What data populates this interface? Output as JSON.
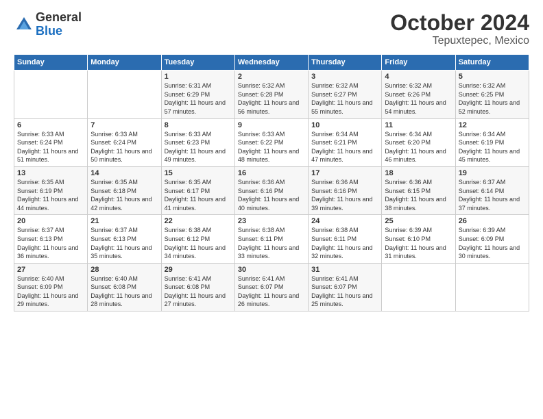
{
  "header": {
    "logo_general": "General",
    "logo_blue": "Blue",
    "title": "October 2024",
    "subtitle": "Tepuxtepec, Mexico"
  },
  "days_of_week": [
    "Sunday",
    "Monday",
    "Tuesday",
    "Wednesday",
    "Thursday",
    "Friday",
    "Saturday"
  ],
  "weeks": [
    [
      {
        "day": "",
        "data": ""
      },
      {
        "day": "",
        "data": ""
      },
      {
        "day": "1",
        "data": "Sunrise: 6:31 AM\nSunset: 6:29 PM\nDaylight: 11 hours and 57 minutes."
      },
      {
        "day": "2",
        "data": "Sunrise: 6:32 AM\nSunset: 6:28 PM\nDaylight: 11 hours and 56 minutes."
      },
      {
        "day": "3",
        "data": "Sunrise: 6:32 AM\nSunset: 6:27 PM\nDaylight: 11 hours and 55 minutes."
      },
      {
        "day": "4",
        "data": "Sunrise: 6:32 AM\nSunset: 6:26 PM\nDaylight: 11 hours and 54 minutes."
      },
      {
        "day": "5",
        "data": "Sunrise: 6:32 AM\nSunset: 6:25 PM\nDaylight: 11 hours and 52 minutes."
      }
    ],
    [
      {
        "day": "6",
        "data": "Sunrise: 6:33 AM\nSunset: 6:24 PM\nDaylight: 11 hours and 51 minutes."
      },
      {
        "day": "7",
        "data": "Sunrise: 6:33 AM\nSunset: 6:24 PM\nDaylight: 11 hours and 50 minutes."
      },
      {
        "day": "8",
        "data": "Sunrise: 6:33 AM\nSunset: 6:23 PM\nDaylight: 11 hours and 49 minutes."
      },
      {
        "day": "9",
        "data": "Sunrise: 6:33 AM\nSunset: 6:22 PM\nDaylight: 11 hours and 48 minutes."
      },
      {
        "day": "10",
        "data": "Sunrise: 6:34 AM\nSunset: 6:21 PM\nDaylight: 11 hours and 47 minutes."
      },
      {
        "day": "11",
        "data": "Sunrise: 6:34 AM\nSunset: 6:20 PM\nDaylight: 11 hours and 46 minutes."
      },
      {
        "day": "12",
        "data": "Sunrise: 6:34 AM\nSunset: 6:19 PM\nDaylight: 11 hours and 45 minutes."
      }
    ],
    [
      {
        "day": "13",
        "data": "Sunrise: 6:35 AM\nSunset: 6:19 PM\nDaylight: 11 hours and 44 minutes."
      },
      {
        "day": "14",
        "data": "Sunrise: 6:35 AM\nSunset: 6:18 PM\nDaylight: 11 hours and 42 minutes."
      },
      {
        "day": "15",
        "data": "Sunrise: 6:35 AM\nSunset: 6:17 PM\nDaylight: 11 hours and 41 minutes."
      },
      {
        "day": "16",
        "data": "Sunrise: 6:36 AM\nSunset: 6:16 PM\nDaylight: 11 hours and 40 minutes."
      },
      {
        "day": "17",
        "data": "Sunrise: 6:36 AM\nSunset: 6:16 PM\nDaylight: 11 hours and 39 minutes."
      },
      {
        "day": "18",
        "data": "Sunrise: 6:36 AM\nSunset: 6:15 PM\nDaylight: 11 hours and 38 minutes."
      },
      {
        "day": "19",
        "data": "Sunrise: 6:37 AM\nSunset: 6:14 PM\nDaylight: 11 hours and 37 minutes."
      }
    ],
    [
      {
        "day": "20",
        "data": "Sunrise: 6:37 AM\nSunset: 6:13 PM\nDaylight: 11 hours and 36 minutes."
      },
      {
        "day": "21",
        "data": "Sunrise: 6:37 AM\nSunset: 6:13 PM\nDaylight: 11 hours and 35 minutes."
      },
      {
        "day": "22",
        "data": "Sunrise: 6:38 AM\nSunset: 6:12 PM\nDaylight: 11 hours and 34 minutes."
      },
      {
        "day": "23",
        "data": "Sunrise: 6:38 AM\nSunset: 6:11 PM\nDaylight: 11 hours and 33 minutes."
      },
      {
        "day": "24",
        "data": "Sunrise: 6:38 AM\nSunset: 6:11 PM\nDaylight: 11 hours and 32 minutes."
      },
      {
        "day": "25",
        "data": "Sunrise: 6:39 AM\nSunset: 6:10 PM\nDaylight: 11 hours and 31 minutes."
      },
      {
        "day": "26",
        "data": "Sunrise: 6:39 AM\nSunset: 6:09 PM\nDaylight: 11 hours and 30 minutes."
      }
    ],
    [
      {
        "day": "27",
        "data": "Sunrise: 6:40 AM\nSunset: 6:09 PM\nDaylight: 11 hours and 29 minutes."
      },
      {
        "day": "28",
        "data": "Sunrise: 6:40 AM\nSunset: 6:08 PM\nDaylight: 11 hours and 28 minutes."
      },
      {
        "day": "29",
        "data": "Sunrise: 6:41 AM\nSunset: 6:08 PM\nDaylight: 11 hours and 27 minutes."
      },
      {
        "day": "30",
        "data": "Sunrise: 6:41 AM\nSunset: 6:07 PM\nDaylight: 11 hours and 26 minutes."
      },
      {
        "day": "31",
        "data": "Sunrise: 6:41 AM\nSunset: 6:07 PM\nDaylight: 11 hours and 25 minutes."
      },
      {
        "day": "",
        "data": ""
      },
      {
        "day": "",
        "data": ""
      }
    ]
  ]
}
